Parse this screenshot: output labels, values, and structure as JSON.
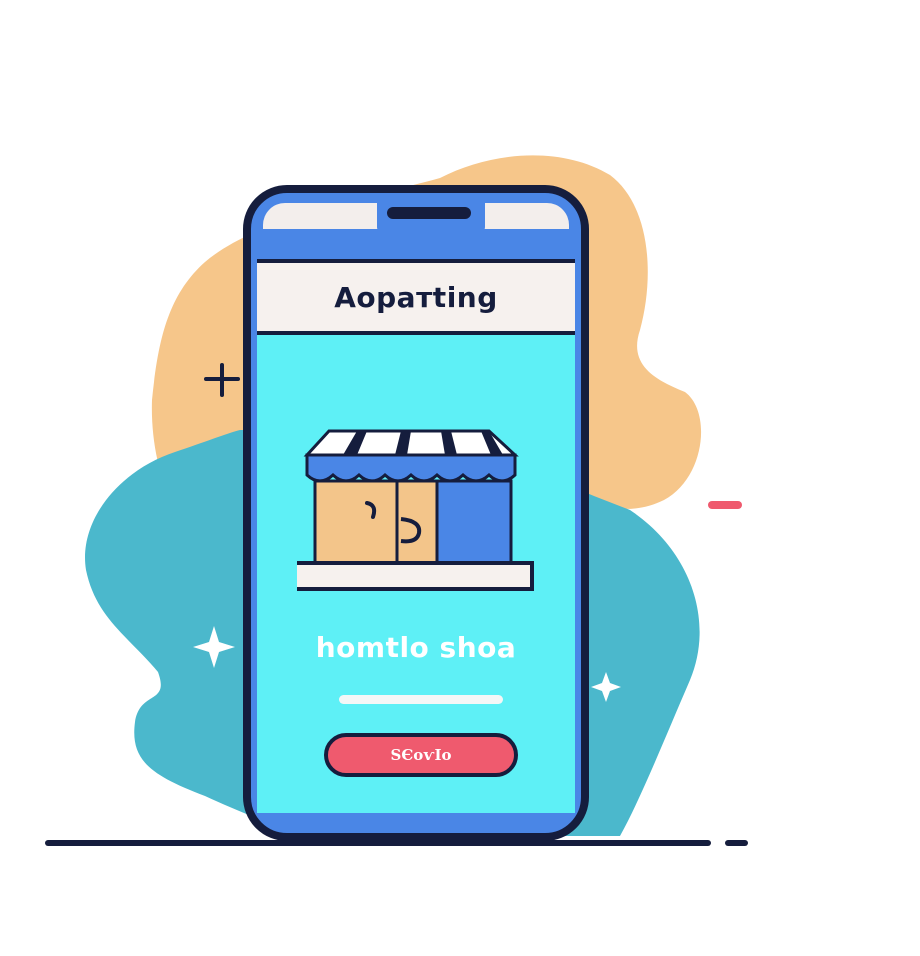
{
  "phone": {
    "header_title": "Aopaтting",
    "shop_name": "homtlo shoa",
    "button_label": "ЅЄоѵІо"
  },
  "icons": {
    "shop": "storefront-icon",
    "plus": "plus-sign-icon",
    "sparkles": "sparkle-icon",
    "minus": "minus-dash-icon"
  },
  "colors": {
    "outline": "#151d3d",
    "phone_body": "#4a86e6",
    "screen": "#5ef0f6",
    "header_band": "#f6f1ee",
    "button": "#ef5a6e",
    "blob_orange": "#f6c68a",
    "blob_teal": "#4bb8cc"
  }
}
